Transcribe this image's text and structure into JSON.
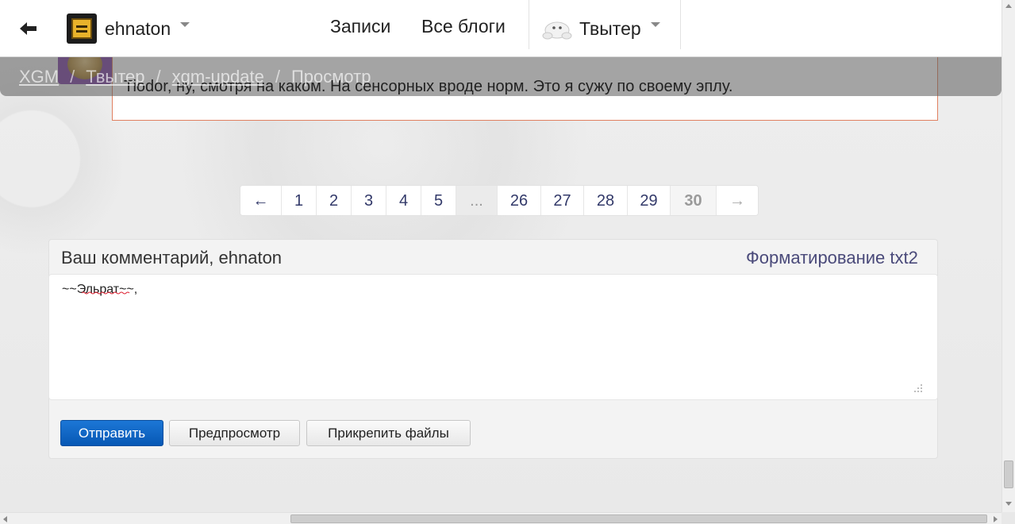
{
  "header": {
    "username": "ehnaton",
    "nav": [
      "Записи",
      "Все блоги"
    ],
    "blog_menu_label": "Твытер"
  },
  "breadcrumb": {
    "items": [
      "XGM",
      "Твытер",
      "xgm-update",
      "Просмотр"
    ],
    "separator": "/"
  },
  "comment": {
    "text": "Tiodor, ну, смотря на каком. На сенсорных вроде норм. Это я сужу по своему эплу."
  },
  "pagination": {
    "prev": "←",
    "pages_start": [
      "1",
      "2",
      "3",
      "4",
      "5"
    ],
    "ellipsis": "...",
    "pages_end": [
      "26",
      "27",
      "28",
      "29"
    ],
    "current": "30",
    "next": "→"
  },
  "form": {
    "heading": "Ваш комментарий, ehnaton",
    "formatting_link": "Форматирование txt2",
    "textarea_value": "~~Эльрат~~,",
    "buttons": {
      "submit": "Отправить",
      "preview": "Предпросмотр",
      "attach": "Прикрепить файлы"
    }
  },
  "colors": {
    "primary_button": "#0758b4",
    "link": "#4a4a7a",
    "comment_border": "#e08060"
  }
}
